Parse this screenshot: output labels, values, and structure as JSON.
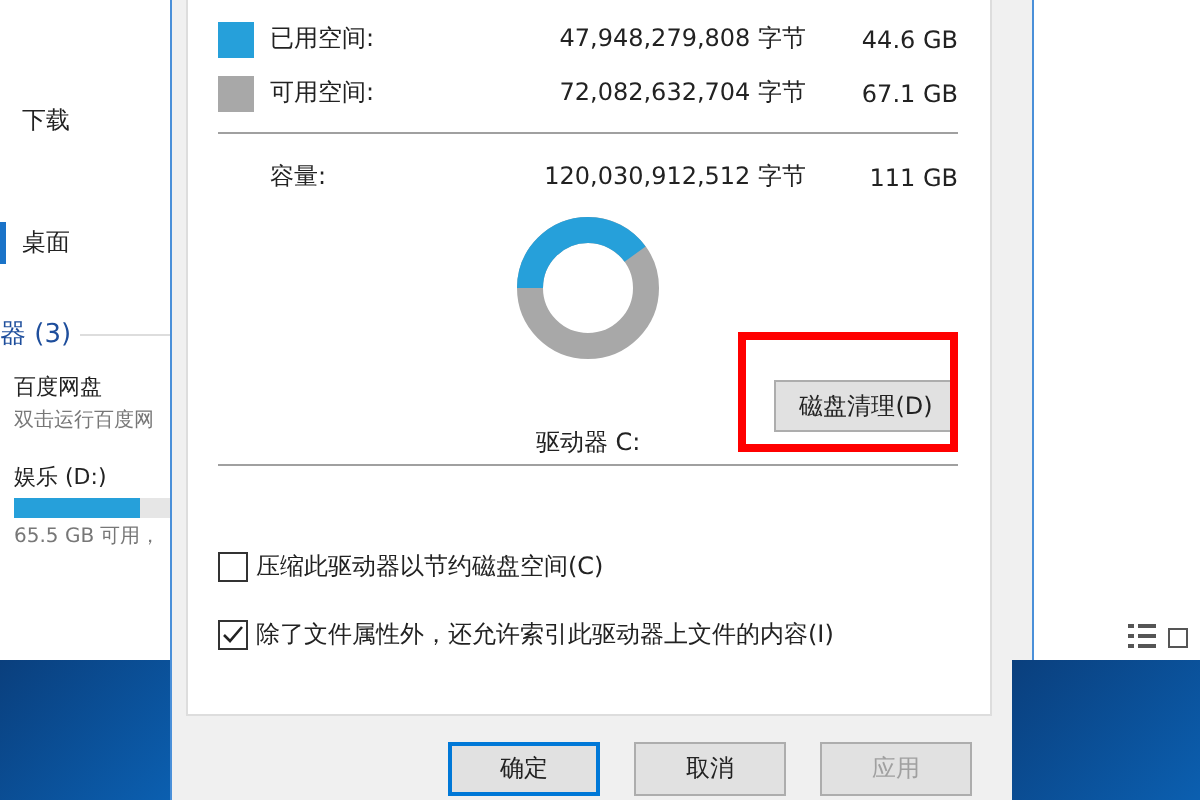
{
  "nav_pane": {
    "items": [
      {
        "label": "下载",
        "selected": false
      },
      {
        "label": "桌面",
        "selected": true
      }
    ],
    "section": "器 (3)",
    "drives": [
      {
        "kind": "app",
        "name": "百度网盘",
        "detail": "双击运行百度网"
      },
      {
        "kind": "drive",
        "name": "娱乐 (D:)",
        "level": 0.81,
        "detail": "65.5 GB 可用，"
      }
    ]
  },
  "dialog": {
    "usage": [
      {
        "label": "已用空间:",
        "bytes": "47,948,279,808 字节",
        "size": "44.6 GB",
        "color": "#26a0da"
      },
      {
        "label": "可用空间:",
        "bytes": "72,082,632,704 字节",
        "size": "67.1 GB",
        "color": "#a8a8a8"
      }
    ],
    "capacity": {
      "label": "容量:",
      "bytes": "120,030,912,512 字节",
      "size": "111 GB"
    },
    "drive_label": "驱动器 C:",
    "cleanup_button": {
      "label": "磁盘清理(D)",
      "highlighted": true
    },
    "options": [
      {
        "label": "压缩此驱动器以节约磁盘空间(C)",
        "checked": false
      },
      {
        "label": "除了文件属性外，还允许索引此驱动器上文件的内容(I)",
        "checked": true
      }
    ],
    "buttons": [
      {
        "label": "确定",
        "kind": "default",
        "disabled": false
      },
      {
        "label": "取消",
        "kind": "normal",
        "disabled": false
      },
      {
        "label": "应用",
        "kind": "normal",
        "disabled": true
      }
    ]
  }
}
